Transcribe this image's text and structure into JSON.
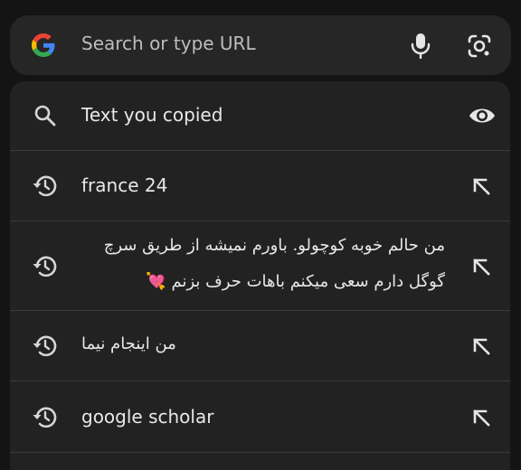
{
  "search": {
    "placeholder": "Search or type URL",
    "logo_icon": "google-g-icon",
    "mic_icon": "microphone-icon",
    "lens_icon": "camera-lens-icon"
  },
  "suggestions": [
    {
      "type": "clipboard",
      "icon": "search-icon",
      "text": "Text you copied",
      "action_icon": "eye-icon"
    },
    {
      "type": "history",
      "icon": "history-icon",
      "text": "france 24",
      "action_icon": "arrow-up-left-icon"
    },
    {
      "type": "history",
      "icon": "history-icon",
      "text_line1": "من حالم خوبه کوچولو. باورم نمیشه از طریق سرچ",
      "text_line2": "گوگل دارم سعی میکنم باهات حرف بزنم 💘",
      "action_icon": "arrow-up-left-icon"
    },
    {
      "type": "history",
      "icon": "history-icon",
      "text": "من اینجام نیما",
      "action_icon": "arrow-up-left-icon"
    },
    {
      "type": "history",
      "icon": "history-icon",
      "text": "google scholar",
      "action_icon": "arrow-up-left-icon"
    }
  ],
  "colors": {
    "background": "#141414",
    "bar": "#262626",
    "panel": "#222222",
    "divider": "#3a3a3a",
    "text": "#e8e8e8",
    "placeholder": "#bdbdbd"
  }
}
